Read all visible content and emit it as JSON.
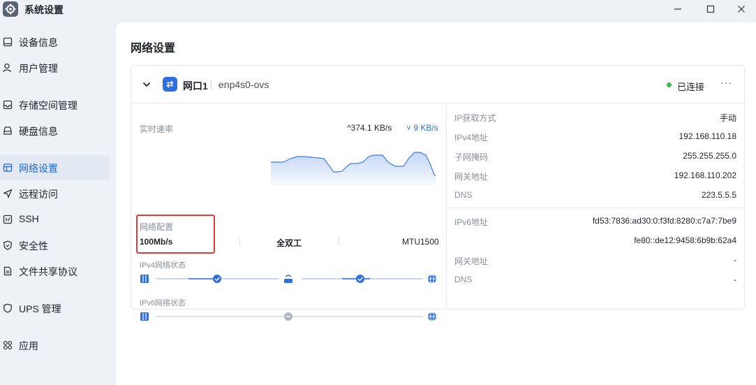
{
  "window": {
    "title": "系统设置",
    "controls": [
      "minimize-icon",
      "maximize-icon",
      "close-icon"
    ]
  },
  "sidebar": {
    "items": [
      {
        "label": "设备信息",
        "icon": "device-icon"
      },
      {
        "label": "用户管理",
        "icon": "user-icon"
      },
      {
        "label": "存储空间管理",
        "icon": "storage-icon"
      },
      {
        "label": "硬盘信息",
        "icon": "disk-icon"
      },
      {
        "label": "网络设置",
        "icon": "network-icon",
        "active": true
      },
      {
        "label": "远程访问",
        "icon": "remote-icon"
      },
      {
        "label": "SSH",
        "icon": "ssh-icon"
      },
      {
        "label": "安全性",
        "icon": "shield-icon"
      },
      {
        "label": "文件共享协议",
        "icon": "file-share-icon"
      },
      {
        "label": "UPS 管理",
        "icon": "ups-icon"
      },
      {
        "label": "应用",
        "icon": "apps-icon"
      }
    ]
  },
  "main": {
    "title": "网络设置",
    "card": {
      "port_name": "网口1",
      "device": "enp4s0-ovs",
      "status": "已连接",
      "status_color": "#3fb950",
      "more": "···",
      "realtime_label": "实时速率",
      "upload": "374.1 KB/s",
      "download": "9 KB/s",
      "config_label": "网络配置",
      "speed": "100Mb/s",
      "duplex": "全双工",
      "mtu": "MTU1500",
      "ipv4_status_label": "IPv4网络状态",
      "ipv6_status_label": "IPv6网络状态",
      "ipv4": {
        "method_label": "IP获取方式",
        "method": "手动",
        "addr_label": "IPv4地址",
        "addr": "192.168.110.18",
        "mask_label": "子网掩码",
        "mask": "255.255.255.0",
        "gw_label": "网关地址",
        "gw": "192.168.110.202",
        "dns_label": "DNS",
        "dns": "223.5.5.5"
      },
      "ipv6": {
        "addr_label": "IPv6地址",
        "addr1": "fd53:7836:ad30:0:f3fd:8280:c7a7:7be9",
        "addr2": "fe80::de12:9458:6b9b:62a4",
        "gw_label": "网关地址",
        "gw": "-",
        "dns_label": "DNS",
        "dns": "-"
      }
    }
  },
  "colors": {
    "accent": "#2f6fe0",
    "highlight": "#e03a3a"
  }
}
